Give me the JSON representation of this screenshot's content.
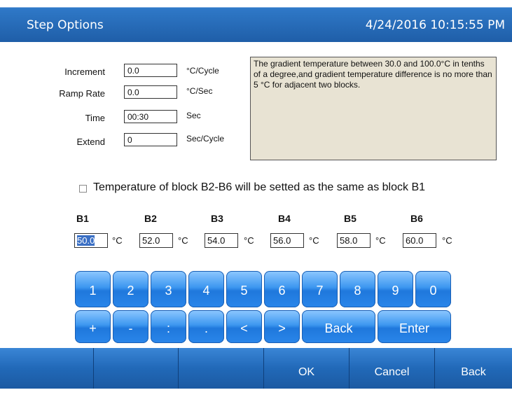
{
  "header": {
    "title": "Step Options",
    "datetime": "4/24/2016 10:15:55 PM"
  },
  "params": [
    {
      "label": "Increment",
      "value": "0.0",
      "unit": "°C/Cycle"
    },
    {
      "label": "Ramp Rate",
      "value": "0.0",
      "unit": "°C/Sec"
    },
    {
      "label": "Time",
      "value": "00:30",
      "unit": "Sec"
    },
    {
      "label": "Extend",
      "value": "0",
      "unit": "Sec/Cycle"
    }
  ],
  "info_text": "The gradient temperature between 30.0 and 100.0°C in tenths of a degree,and gradient temperature difference is no more than 5 °C for adjacent two blocks.",
  "same_temp_checkbox": {
    "checked": false,
    "label": "Temperature of block B2-B6 will be setted as the same as block B1"
  },
  "blocks": [
    {
      "name": "B1",
      "value": "50.0",
      "unit": "°C"
    },
    {
      "name": "B2",
      "value": "52.0",
      "unit": "°C"
    },
    {
      "name": "B3",
      "value": "54.0",
      "unit": "°C"
    },
    {
      "name": "B4",
      "value": "56.0",
      "unit": "°C"
    },
    {
      "name": "B5",
      "value": "58.0",
      "unit": "°C"
    },
    {
      "name": "B6",
      "value": "60.0",
      "unit": "°C"
    }
  ],
  "keypad": {
    "row1": [
      "1",
      "2",
      "3",
      "4",
      "5",
      "6",
      "7",
      "8",
      "9",
      "0"
    ],
    "row2": [
      "+",
      "-",
      ":",
      ".",
      "<",
      ">",
      "Back",
      "Enter"
    ]
  },
  "bottom_bar": [
    "",
    "",
    "",
    "OK",
    "Cancel",
    "Back"
  ],
  "colors": {
    "title_blue": "#1f5ea8",
    "key_blue": "#2a86ea",
    "info_bg": "#e8e3d3"
  }
}
